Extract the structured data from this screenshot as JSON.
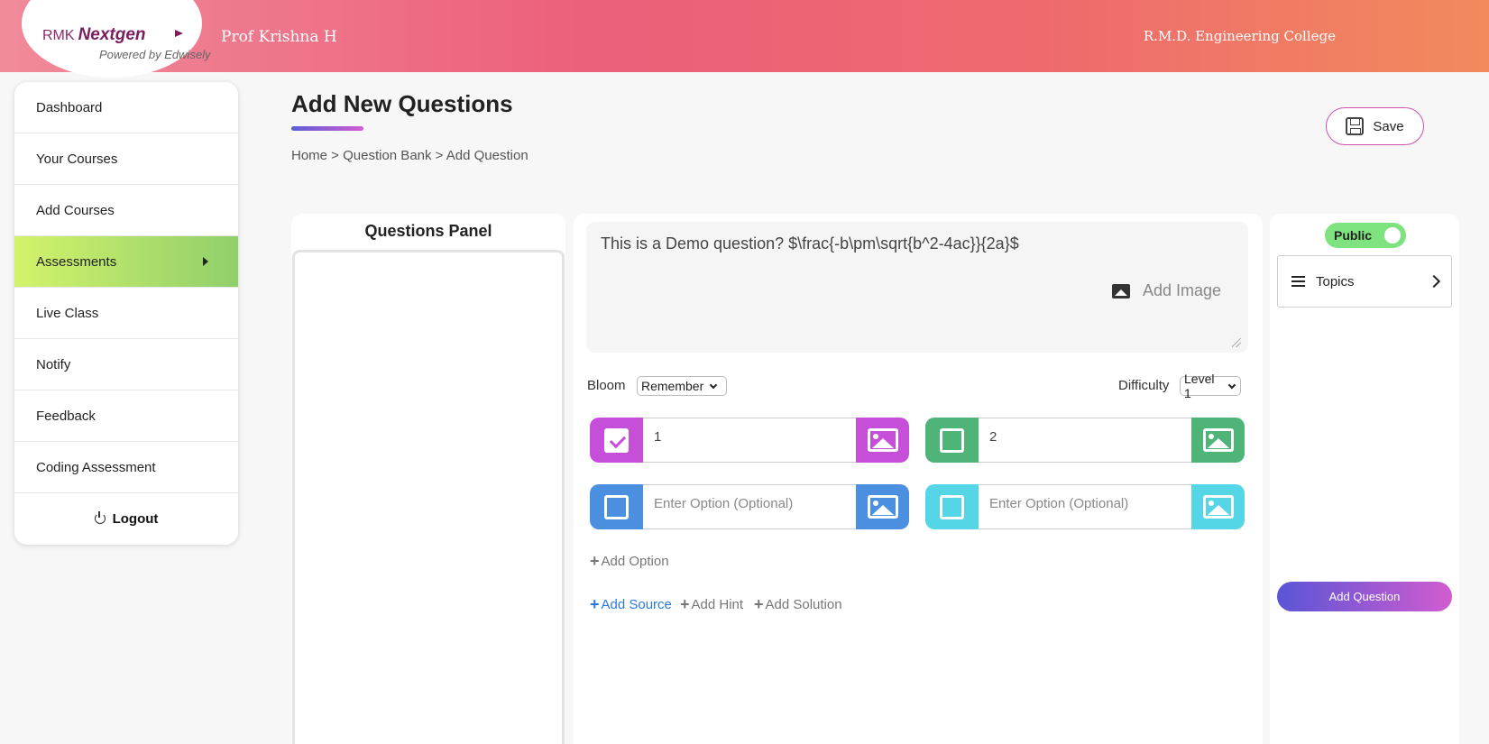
{
  "header": {
    "logo_prefix": "RMK",
    "logo_name": "Nextgen",
    "logo_tagline": "Powered by Edwisely",
    "user_name": "Prof Krishna H",
    "college": "R.M.D. Engineering College"
  },
  "sidebar": {
    "items": [
      {
        "label": "Dashboard"
      },
      {
        "label": "Your Courses"
      },
      {
        "label": "Add Courses"
      },
      {
        "label": "Assessments"
      },
      {
        "label": "Live Class"
      },
      {
        "label": "Notify"
      },
      {
        "label": "Feedback"
      },
      {
        "label": "Coding Assessment"
      }
    ],
    "active_item": "Assessments",
    "logout_label": "Logout"
  },
  "page": {
    "title": "Add New Questions",
    "breadcrumb": "Home > Question Bank > Add Question",
    "save_label": "Save"
  },
  "questions_panel": {
    "title": "Questions Panel"
  },
  "editor": {
    "question_text": "This is a Demo question?  $\\frac{-b\\pm\\sqrt{b^2-4ac}}{2a}$",
    "add_image_label": "Add Image",
    "bloom_label": "Bloom",
    "bloom_value": "Remember",
    "difficulty_label": "Difficulty",
    "difficulty_value": "Level 1",
    "options": [
      {
        "value": "1",
        "checked": true,
        "color": "#c64fd9"
      },
      {
        "value": "2",
        "checked": false,
        "color": "#4fb477"
      },
      {
        "value": "",
        "placeholder": "Enter Option (Optional)",
        "checked": false,
        "color": "#4b8fe0"
      },
      {
        "value": "",
        "placeholder": "Enter Option (Optional)",
        "checked": false,
        "color": "#55d6e6"
      }
    ],
    "add_option_label": "Add Option",
    "add_source_label": "Add Source",
    "add_hint_label": "Add Hint",
    "add_solution_label": "Add Solution"
  },
  "right_panel": {
    "visibility_label": "Public",
    "topics_label": "Topics",
    "add_question_label": "Add Question"
  }
}
